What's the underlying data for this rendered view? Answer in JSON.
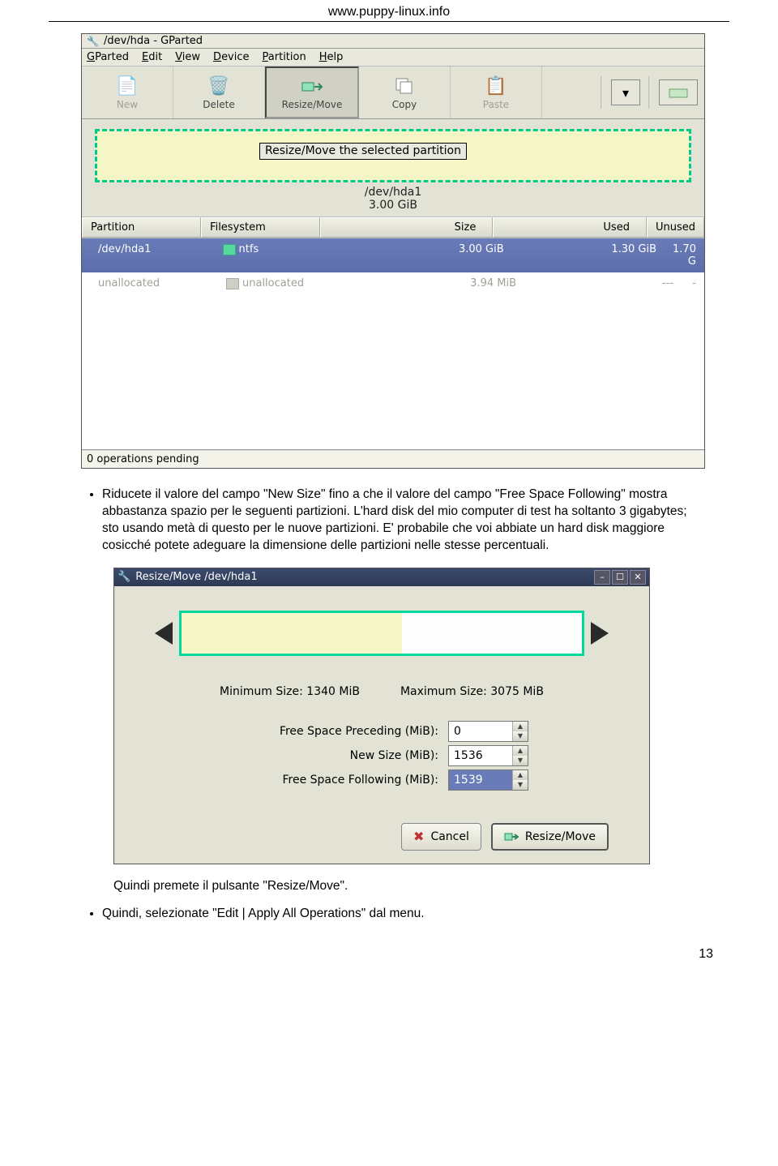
{
  "header_url": "www.puppy-linux.info",
  "gparted": {
    "title": "/dev/hda - GParted",
    "menu": [
      "GParted",
      "Edit",
      "View",
      "Device",
      "Partition",
      "Help"
    ],
    "menu_accel": [
      "G",
      "E",
      "V",
      "D",
      "P",
      "H"
    ],
    "toolbar": {
      "new": "New",
      "delete": "Delete",
      "resize": "Resize/Move",
      "copy": "Copy",
      "paste": "Paste"
    },
    "tooltip": "Resize/Move the selected partition",
    "partition_label": "/dev/hda1",
    "partition_size": "3.00 GiB",
    "columns": {
      "partition": "Partition",
      "filesystem": "Filesystem",
      "size": "Size",
      "used": "Used",
      "unused": "Unused"
    },
    "rows": [
      {
        "partition": "/dev/hda1",
        "fs": "ntfs",
        "size": "3.00 GiB",
        "used": "1.30 GiB",
        "unused": "1.70 G",
        "sel": true
      },
      {
        "partition": "unallocated",
        "fs": "unallocated",
        "size": "3.94 MiB",
        "used": "---",
        "unused": "-",
        "sel": false
      }
    ],
    "status": "0 operations pending"
  },
  "para1": "Riducete il valore del campo \"New Size\" fino a che il valore del campo \"Free Space Following\" mostra abbastanza spazio per le seguenti partizioni. L'hard disk del mio computer di test ha soltanto 3 gigabytes; sto usando metà di questo per le nuove partizioni. E' probabile che voi abbiate un hard disk maggiore cosicché potete adeguare la dimensione delle partizioni nelle stesse percentuali.",
  "dialog": {
    "title": "Resize/Move /dev/hda1",
    "min_label": "Minimum Size: 1340 MiB",
    "max_label": "Maximum Size: 3075 MiB",
    "fsp_label": "Free Space Preceding (MiB):",
    "fsp_value": "0",
    "ns_label": "New Size (MiB):",
    "ns_value": "1536",
    "fsf_label": "Free Space Following (MiB):",
    "fsf_value": "1539",
    "cancel": "Cancel",
    "resize": "Resize/Move"
  },
  "para2": "Quindi premete il pulsante \"Resize/Move\".",
  "para3": "Quindi, selezionate \"Edit | Apply All Operations\" dal menu.",
  "page_number": "13"
}
